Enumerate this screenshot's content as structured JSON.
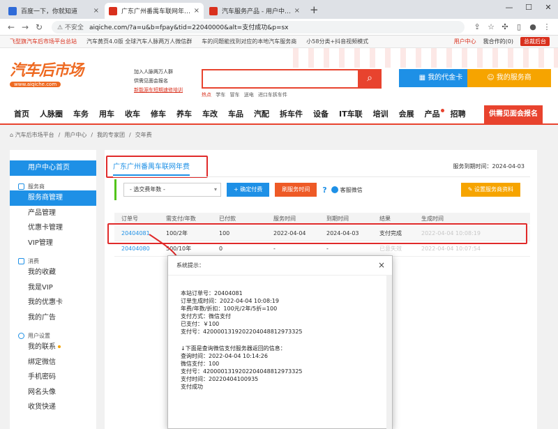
{
  "browser": {
    "tabs": [
      {
        "title": "百度一下，你就知道",
        "fav_color": "#2f6bd8"
      },
      {
        "title": "广东广州番禺车联网年费 - 用户中心",
        "fav_color": "#d9301d"
      },
      {
        "title": "汽车服务产品 - 用户中心 - 汽车后市场",
        "fav_color": "#d9301d"
      }
    ],
    "new_tab": "+",
    "security": "⚠ 不安全",
    "url": "aiqiche.com/?a=u&b=fpay&tid=22040000&alt=支付成功&p=sx"
  },
  "infobar": {
    "items": [
      "飞型旗汽车后市场平台总站",
      "汽车黄页4.0版 全球汽车人脉两万人微信群",
      "车的问题能找到对应的本地汽车服务商",
      "小58分类+抖音视频模式"
    ],
    "user_center": "用户中心",
    "my_coop": "我合作的(0)",
    "back": "总裁后台"
  },
  "header": {
    "logo_main": "汽车后市场",
    "logo_sub": "www.aiqiche.com",
    "slogan": [
      "加入人脉两万人群",
      "供需见面会报名",
      "新能源车短期速修培训"
    ],
    "search_placeholder": "",
    "hot_label": "热点",
    "hot_items": [
      "学车",
      "冒车",
      "送电",
      "进口车拆车件"
    ],
    "btn_card": "我的代金卡",
    "btn_provider": "我的服务商"
  },
  "nav": {
    "items": [
      "首页",
      "人脉圈",
      "车务",
      "用车",
      "收车",
      "修车",
      "养车",
      "车改",
      "车品",
      "汽配",
      "拆车件",
      "设备",
      "IT车联",
      "培训",
      "会展",
      "产品",
      "招聘"
    ],
    "cta": "供需见面会报名"
  },
  "breadcrumb": [
    "⌂ 汽车后市场平台",
    "/",
    "用户中心",
    "/",
    "我的专家团",
    "/",
    "交年费"
  ],
  "sidebar": {
    "home": "用户中心首页",
    "sec1": "服务商",
    "sec1_items": [
      "服务商管理",
      "产品管理",
      "优惠卡管理",
      "VIP管理"
    ],
    "sec2": "消费",
    "sec2_items": [
      "我的收藏",
      "我是VIP",
      "我的优惠卡",
      "我的广告"
    ],
    "sec3": "用户设置",
    "sec3_items": [
      "我的联系",
      "绑定微信",
      "手机密码",
      "网名头像",
      "收货快递"
    ]
  },
  "content": {
    "title": "广东广州番禺车联网年费",
    "expire": "服务到期时间：2024-04-03",
    "select": "- 选交费年数 -",
    "btn_confirm": "+ 确定付费",
    "btn_refresh": "刷服务时间",
    "q": "?",
    "service": "客服微信",
    "btn_setup": "✎ 设置服务商资料",
    "headers": [
      "订单号",
      "需支付/年数",
      "已付款",
      "服务时间",
      "到期时间",
      "结果",
      "生成时间"
    ],
    "rows": [
      [
        "20404081",
        "100/2年",
        "100",
        "2022-04-04",
        "2024-04-03",
        "支付完成",
        "2022-04-04 10:08:19"
      ],
      [
        "20404080",
        "500/10年",
        "0",
        "-",
        "-",
        "已意失效",
        "2022-04-04 10:07:54"
      ]
    ]
  },
  "modal": {
    "title": "系统提示：",
    "close": "×",
    "lines": [
      "本站订单号：20404081",
      "订单生成时间：2022-04-04 10:08:19",
      "年费/年数/折扣：100元/2年/5折=100",
      "支付方式：微信支付",
      "已支付：￥100",
      "支付号：4200001319202204048812973325"
    ],
    "lines2": [
      "↓下面是查询微信支付服务器返回的信息：",
      "查询时间：2022-04-04 10:14:26",
      "微信支付：100",
      "支付号：4200001319202204048812973325",
      "支付时间：20220404100935",
      "支付成功"
    ]
  }
}
